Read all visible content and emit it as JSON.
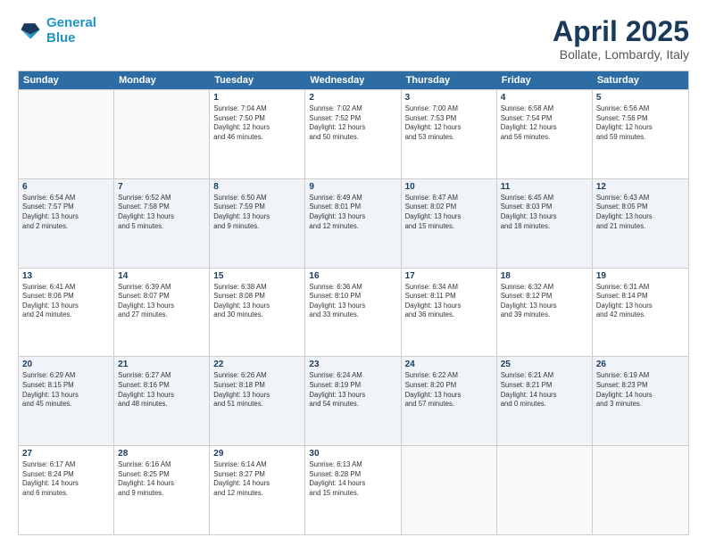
{
  "header": {
    "logo_line1": "General",
    "logo_line2": "Blue",
    "month": "April 2025",
    "location": "Bollate, Lombardy, Italy"
  },
  "weekdays": [
    "Sunday",
    "Monday",
    "Tuesday",
    "Wednesday",
    "Thursday",
    "Friday",
    "Saturday"
  ],
  "rows": [
    [
      {
        "day": "",
        "text": "",
        "empty": true
      },
      {
        "day": "",
        "text": "",
        "empty": true
      },
      {
        "day": "1",
        "text": "Sunrise: 7:04 AM\nSunset: 7:50 PM\nDaylight: 12 hours\nand 46 minutes."
      },
      {
        "day": "2",
        "text": "Sunrise: 7:02 AM\nSunset: 7:52 PM\nDaylight: 12 hours\nand 50 minutes."
      },
      {
        "day": "3",
        "text": "Sunrise: 7:00 AM\nSunset: 7:53 PM\nDaylight: 12 hours\nand 53 minutes."
      },
      {
        "day": "4",
        "text": "Sunrise: 6:58 AM\nSunset: 7:54 PM\nDaylight: 12 hours\nand 56 minutes."
      },
      {
        "day": "5",
        "text": "Sunrise: 6:56 AM\nSunset: 7:56 PM\nDaylight: 12 hours\nand 59 minutes."
      }
    ],
    [
      {
        "day": "6",
        "text": "Sunrise: 6:54 AM\nSunset: 7:57 PM\nDaylight: 13 hours\nand 2 minutes."
      },
      {
        "day": "7",
        "text": "Sunrise: 6:52 AM\nSunset: 7:58 PM\nDaylight: 13 hours\nand 5 minutes."
      },
      {
        "day": "8",
        "text": "Sunrise: 6:50 AM\nSunset: 7:59 PM\nDaylight: 13 hours\nand 9 minutes."
      },
      {
        "day": "9",
        "text": "Sunrise: 6:49 AM\nSunset: 8:01 PM\nDaylight: 13 hours\nand 12 minutes."
      },
      {
        "day": "10",
        "text": "Sunrise: 6:47 AM\nSunset: 8:02 PM\nDaylight: 13 hours\nand 15 minutes."
      },
      {
        "day": "11",
        "text": "Sunrise: 6:45 AM\nSunset: 8:03 PM\nDaylight: 13 hours\nand 18 minutes."
      },
      {
        "day": "12",
        "text": "Sunrise: 6:43 AM\nSunset: 8:05 PM\nDaylight: 13 hours\nand 21 minutes."
      }
    ],
    [
      {
        "day": "13",
        "text": "Sunrise: 6:41 AM\nSunset: 8:06 PM\nDaylight: 13 hours\nand 24 minutes."
      },
      {
        "day": "14",
        "text": "Sunrise: 6:39 AM\nSunset: 8:07 PM\nDaylight: 13 hours\nand 27 minutes."
      },
      {
        "day": "15",
        "text": "Sunrise: 6:38 AM\nSunset: 8:08 PM\nDaylight: 13 hours\nand 30 minutes."
      },
      {
        "day": "16",
        "text": "Sunrise: 6:36 AM\nSunset: 8:10 PM\nDaylight: 13 hours\nand 33 minutes."
      },
      {
        "day": "17",
        "text": "Sunrise: 6:34 AM\nSunset: 8:11 PM\nDaylight: 13 hours\nand 36 minutes."
      },
      {
        "day": "18",
        "text": "Sunrise: 6:32 AM\nSunset: 8:12 PM\nDaylight: 13 hours\nand 39 minutes."
      },
      {
        "day": "19",
        "text": "Sunrise: 6:31 AM\nSunset: 8:14 PM\nDaylight: 13 hours\nand 42 minutes."
      }
    ],
    [
      {
        "day": "20",
        "text": "Sunrise: 6:29 AM\nSunset: 8:15 PM\nDaylight: 13 hours\nand 45 minutes."
      },
      {
        "day": "21",
        "text": "Sunrise: 6:27 AM\nSunset: 8:16 PM\nDaylight: 13 hours\nand 48 minutes."
      },
      {
        "day": "22",
        "text": "Sunrise: 6:26 AM\nSunset: 8:18 PM\nDaylight: 13 hours\nand 51 minutes."
      },
      {
        "day": "23",
        "text": "Sunrise: 6:24 AM\nSunset: 8:19 PM\nDaylight: 13 hours\nand 54 minutes."
      },
      {
        "day": "24",
        "text": "Sunrise: 6:22 AM\nSunset: 8:20 PM\nDaylight: 13 hours\nand 57 minutes."
      },
      {
        "day": "25",
        "text": "Sunrise: 6:21 AM\nSunset: 8:21 PM\nDaylight: 14 hours\nand 0 minutes."
      },
      {
        "day": "26",
        "text": "Sunrise: 6:19 AM\nSunset: 8:23 PM\nDaylight: 14 hours\nand 3 minutes."
      }
    ],
    [
      {
        "day": "27",
        "text": "Sunrise: 6:17 AM\nSunset: 8:24 PM\nDaylight: 14 hours\nand 6 minutes."
      },
      {
        "day": "28",
        "text": "Sunrise: 6:16 AM\nSunset: 8:25 PM\nDaylight: 14 hours\nand 9 minutes."
      },
      {
        "day": "29",
        "text": "Sunrise: 6:14 AM\nSunset: 8:27 PM\nDaylight: 14 hours\nand 12 minutes."
      },
      {
        "day": "30",
        "text": "Sunrise: 6:13 AM\nSunset: 8:28 PM\nDaylight: 14 hours\nand 15 minutes."
      },
      {
        "day": "",
        "text": "",
        "empty": true
      },
      {
        "day": "",
        "text": "",
        "empty": true
      },
      {
        "day": "",
        "text": "",
        "empty": true
      }
    ]
  ]
}
